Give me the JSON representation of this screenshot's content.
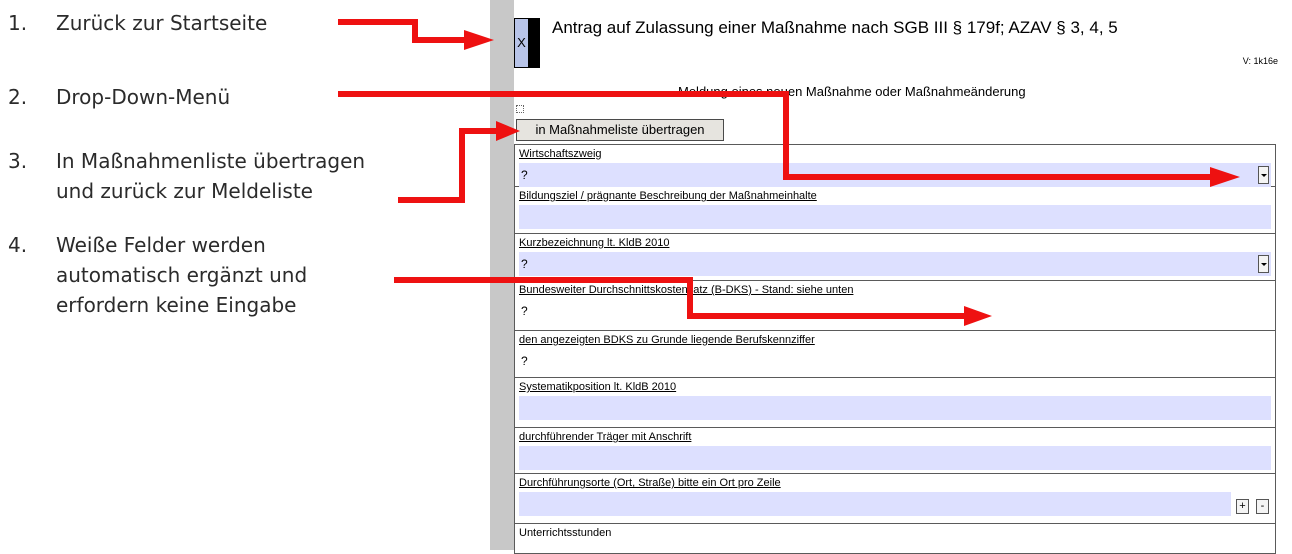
{
  "annotations": [
    {
      "num": "1.",
      "lines": [
        "Zurück zur Startseite"
      ]
    },
    {
      "num": "2.",
      "lines": [
        "Drop-Down-Menü"
      ]
    },
    {
      "num": "3.",
      "lines": [
        "In Maßnahmenliste übertragen",
        "und zurück zur Meldeliste"
      ]
    },
    {
      "num": "4.",
      "lines": [
        "Weiße Felder werden",
        "automatisch ergänzt und",
        "erfordern keine Eingabe"
      ]
    }
  ],
  "document": {
    "home_box_label": "X",
    "title": "Antrag auf Zulassung einer Maßnahme nach SGB III § 179f; AZAV § 3, 4, 5",
    "version": "V: 1k16e",
    "subtitle": "Meldung eines neuen Maßnahme oder Maßnahmeänderung",
    "transfer_button": "in Maßnahmeliste übertragen"
  },
  "form": {
    "fields": [
      {
        "label": "Wirtschaftszweig",
        "value": "?"
      },
      {
        "label": "Bildungsziel / prägnante Beschreibung der Maßnahmeinhalte",
        "value": ""
      },
      {
        "label": "Kurzbezeichnung lt. KldB 2010",
        "value": "?"
      },
      {
        "label": "Bundesweiter Durchschnittskostensatz (B-DKS) - Stand: siehe unten",
        "value": "?"
      },
      {
        "label": "den angezeigten BDKS zu Grunde liegende Berufskennziffer",
        "value": "?"
      },
      {
        "label": "Systematikposition lt. KldB 2010",
        "value": ""
      },
      {
        "label": "durchführender Träger mit Anschrift",
        "value": ""
      },
      {
        "label": "Durchführungsorte (Ort, Straße)     bitte ein Ort pro Zeile",
        "value": ""
      },
      {
        "label": "Unterrichtsstunden",
        "value": ""
      }
    ],
    "add_label": "+",
    "remove_label": "-"
  },
  "colors": {
    "arrow": "#ee1111",
    "input_fill": "#dde0ff",
    "gutter": "#c8c8c8"
  }
}
